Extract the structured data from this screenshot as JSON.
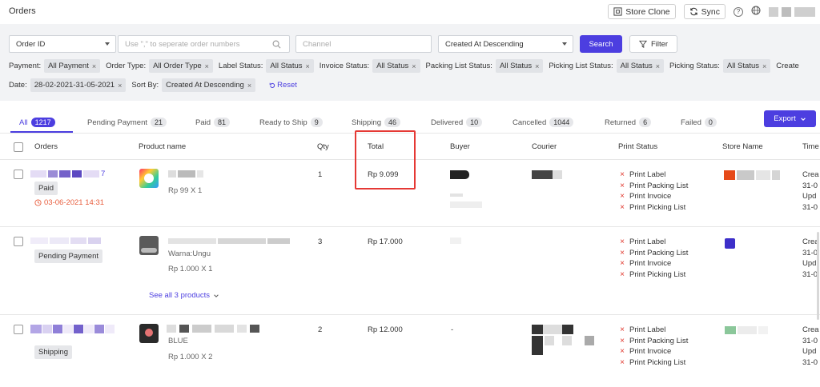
{
  "header": {
    "title": "Orders",
    "store_clone_label": "Store Clone",
    "sync_label": "Sync",
    "help_glyph": "?"
  },
  "filters": {
    "order_id_select": "Order ID",
    "order_search_placeholder": "Use \",\" to seperate order numbers",
    "channel_placeholder": "Channel",
    "sort_select": "Created At Descending",
    "search_label": "Search",
    "filter_label": "Filter",
    "chips_row1": [
      {
        "label": "Payment:",
        "value": "All Payment"
      },
      {
        "label": "Order Type:",
        "value": "All Order Type"
      },
      {
        "label": "Label Status:",
        "value": "All Status"
      },
      {
        "label": "Invoice Status:",
        "value": "All Status"
      },
      {
        "label": "Packing List Status:",
        "value": "All Status"
      },
      {
        "label": "Picking List Status:",
        "value": "All Status"
      },
      {
        "label": "Picking Status:",
        "value": "All Status"
      }
    ],
    "trailing_label": "Create",
    "chips_row2": [
      {
        "label": "Date:",
        "value": "28-02-2021-31-05-2021"
      },
      {
        "label": "Sort By:",
        "value": "Created At Descending"
      }
    ],
    "reset_label": "Reset",
    "chip_close_glyph": "×"
  },
  "tabs": [
    {
      "label": "All",
      "count": "1217"
    },
    {
      "label": "Pending Payment",
      "count": "21"
    },
    {
      "label": "Paid",
      "count": "81"
    },
    {
      "label": "Ready to Ship",
      "count": "9"
    },
    {
      "label": "Shipping",
      "count": "46"
    },
    {
      "label": "Delivered",
      "count": "10"
    },
    {
      "label": "Cancelled",
      "count": "1044"
    },
    {
      "label": "Returned",
      "count": "6"
    },
    {
      "label": "Failed",
      "count": "0"
    }
  ],
  "export_label": "Export",
  "table": {
    "headers": {
      "orders": "Orders",
      "product": "Product name",
      "qty": "Qty",
      "total": "Total",
      "buyer": "Buyer",
      "courier": "Courier",
      "print_status": "Print Status",
      "store": "Store Name",
      "time": "Time"
    },
    "print_items": [
      "Print Label",
      "Print Packing List",
      "Print Invoice",
      "Print Picking List"
    ],
    "print_x_glyph": "×",
    "rows": [
      {
        "order_suffix": "7",
        "status": "Paid",
        "deadline": "03-06-2021 14:31",
        "product_variant": "",
        "product_price": "Rp 99 X 1",
        "qty": "1",
        "total": "Rp 9.099",
        "buyer_text": "",
        "time_lines": [
          "Crea",
          "31-0",
          "Upd",
          "31-0"
        ]
      },
      {
        "order_suffix": "",
        "status": "Pending Payment",
        "deadline": "",
        "product_variant": "Warna:Ungu",
        "product_price": "Rp 1.000 X 1",
        "see_all": "See all 3 products",
        "qty": "3",
        "total": "Rp 17.000",
        "buyer_text": "",
        "time_lines": [
          "Crea",
          "31-0",
          "Upd",
          "31-0"
        ]
      },
      {
        "order_suffix": "",
        "status": "Shipping",
        "deadline": "",
        "product_variant": "BLUE",
        "product_price": "Rp 1.000 X 2",
        "qty": "2",
        "total": "Rp 12.000",
        "buyer_text": "-",
        "time_lines": [
          "Crea",
          "31-0",
          "Upd",
          "31-0"
        ]
      }
    ]
  },
  "colors": {
    "accent": "#4c3ee0",
    "danger": "#e0362c",
    "highlight": "#e53935"
  }
}
